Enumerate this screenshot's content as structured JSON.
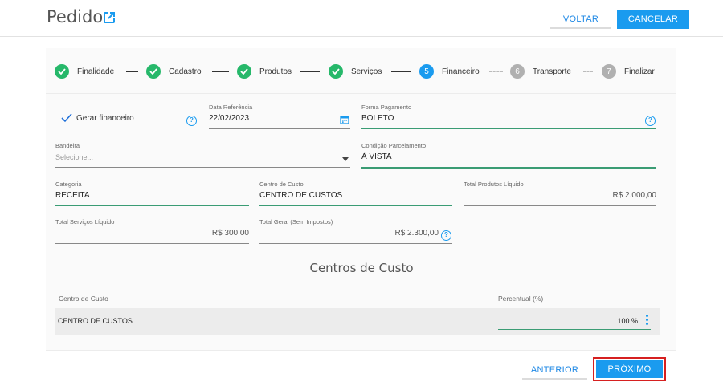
{
  "header": {
    "title": "Pedido",
    "voltar_label": "VOLTAR",
    "cancelar_label": "CANCELAR"
  },
  "stepper": {
    "steps": [
      {
        "label": "Finalidade",
        "number": "",
        "state": "done"
      },
      {
        "label": "Cadastro",
        "number": "",
        "state": "done"
      },
      {
        "label": "Produtos",
        "number": "",
        "state": "done"
      },
      {
        "label": "Serviços",
        "number": "",
        "state": "done"
      },
      {
        "label": "Financeiro",
        "number": "5",
        "state": "active"
      },
      {
        "label": "Transporte",
        "number": "6",
        "state": "todo"
      },
      {
        "label": "Finalizar",
        "number": "7",
        "state": "todo"
      }
    ]
  },
  "form": {
    "gerar_financeiro": {
      "label": "Gerar financeiro",
      "checked": true
    },
    "data_referencia": {
      "label": "Data Referência",
      "value": "22/02/2023"
    },
    "forma_pagamento": {
      "label": "Forma Pagamento",
      "value": "BOLETO"
    },
    "bandeira": {
      "label": "Bandeira",
      "placeholder": "Selecione..."
    },
    "condicao_parcelamento": {
      "label": "Condição Parcelamento",
      "value": "À VISTA"
    },
    "categoria": {
      "label": "Categoria",
      "value": "RECEITA"
    },
    "centro_de_custo": {
      "label": "Centro de Custo",
      "value": "CENTRO DE CUSTOS"
    },
    "total_produtos": {
      "label": "Total Produtos Líquido",
      "value": "R$ 2.000,00"
    },
    "total_servicos": {
      "label": "Total Serviços Líquido",
      "value": "R$ 300,00"
    },
    "total_geral": {
      "label": "Total Geral (Sem Impostos)",
      "value": "R$ 2.300,00"
    }
  },
  "centros_de_custo": {
    "title": "Centros de Custo",
    "columns": [
      "Centro de Custo",
      "Percentual (%)"
    ],
    "rows": [
      {
        "name": "CENTRO DE CUSTOS",
        "percent": "100 %"
      }
    ]
  },
  "footer": {
    "anterior_label": "ANTERIOR",
    "proximo_label": "PRÓXIMO"
  },
  "colors": {
    "accent": "#1a9bef",
    "done": "#26b86a",
    "todo": "#b0b0b0",
    "highlight": "#d62020"
  }
}
